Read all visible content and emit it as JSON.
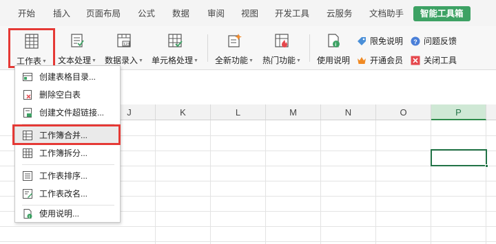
{
  "menu": {
    "tabs": [
      {
        "label": "开始"
      },
      {
        "label": "插入"
      },
      {
        "label": "页面布局"
      },
      {
        "label": "公式"
      },
      {
        "label": "数据"
      },
      {
        "label": "审阅"
      },
      {
        "label": "视图"
      },
      {
        "label": "开发工具"
      },
      {
        "label": "云服务"
      },
      {
        "label": "文档助手"
      },
      {
        "label": "智能工具箱"
      }
    ],
    "active_tab": "智能工具箱"
  },
  "ribbon": {
    "buttons": [
      {
        "label": "工作表",
        "icon": "worksheet-icon",
        "highlighted": true
      },
      {
        "label": "文本处理",
        "icon": "text-process-icon"
      },
      {
        "label": "数据录入",
        "icon": "data-entry-icon"
      },
      {
        "label": "单元格处理",
        "icon": "cell-process-icon"
      },
      {
        "label": "全新功能",
        "icon": "new-feature-icon"
      },
      {
        "label": "热门功能",
        "icon": "hot-feature-icon"
      },
      {
        "label": "使用说明",
        "icon": "help-doc-icon"
      }
    ],
    "small_buttons": [
      {
        "label": "限免说明",
        "icon": "tag-icon"
      },
      {
        "label": "问题反馈",
        "icon": "question-icon"
      },
      {
        "label": "开通会员",
        "icon": "crown-icon"
      },
      {
        "label": "关闭工具",
        "icon": "close-box-icon"
      }
    ]
  },
  "grid": {
    "columns": [
      "J",
      "K",
      "L",
      "M",
      "N",
      "O",
      "P"
    ],
    "selected_column": "P"
  },
  "dropdown": {
    "items": [
      {
        "label": "创建表格目录...",
        "icon": "table-index-icon"
      },
      {
        "label": "删除空白表",
        "icon": "delete-sheet-icon"
      },
      {
        "label": "创建文件超链接...",
        "icon": "hyperlink-icon"
      },
      {
        "label": "工作簿合并...",
        "icon": "merge-workbook-icon",
        "highlighted": true
      },
      {
        "label": "工作簿拆分...",
        "icon": "split-workbook-icon"
      },
      {
        "label": "工作表排序...",
        "icon": "sort-sheet-icon"
      },
      {
        "label": "工作表改名...",
        "icon": "rename-sheet-icon"
      },
      {
        "label": "使用说明...",
        "icon": "help-doc-icon"
      }
    ]
  },
  "colors": {
    "accent": "#3da264",
    "highlight_box": "#e53935",
    "selection": "#217346"
  }
}
